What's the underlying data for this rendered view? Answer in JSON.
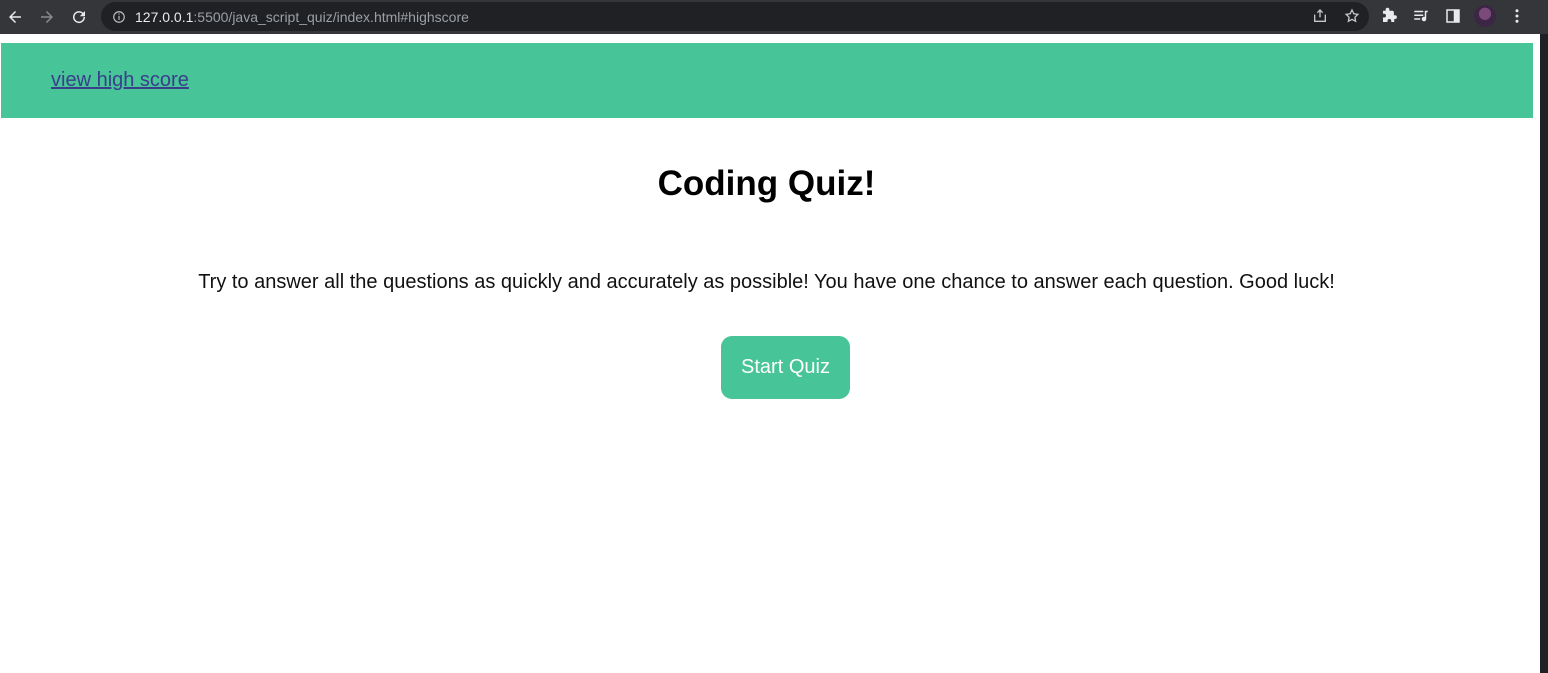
{
  "browser": {
    "url_host": "127.0.0.1",
    "url_rest": ":5500/java_script_quiz/index.html#highscore",
    "icons": [
      "back-arrow-icon",
      "forward-arrow-icon",
      "reload-icon",
      "info-icon",
      "share-icon",
      "star-icon",
      "puzzle-icon",
      "media-queue-icon",
      "side-panel-icon",
      "avatar",
      "more-vert-icon"
    ]
  },
  "header": {
    "highscore_link": "view high score",
    "background_color": "#48c499"
  },
  "main": {
    "title": "Coding Quiz!",
    "description": "Try to answer all the questions as quickly and accurately as possible! You have one chance to answer each question. Good luck!",
    "start_button": "Start Quiz"
  }
}
